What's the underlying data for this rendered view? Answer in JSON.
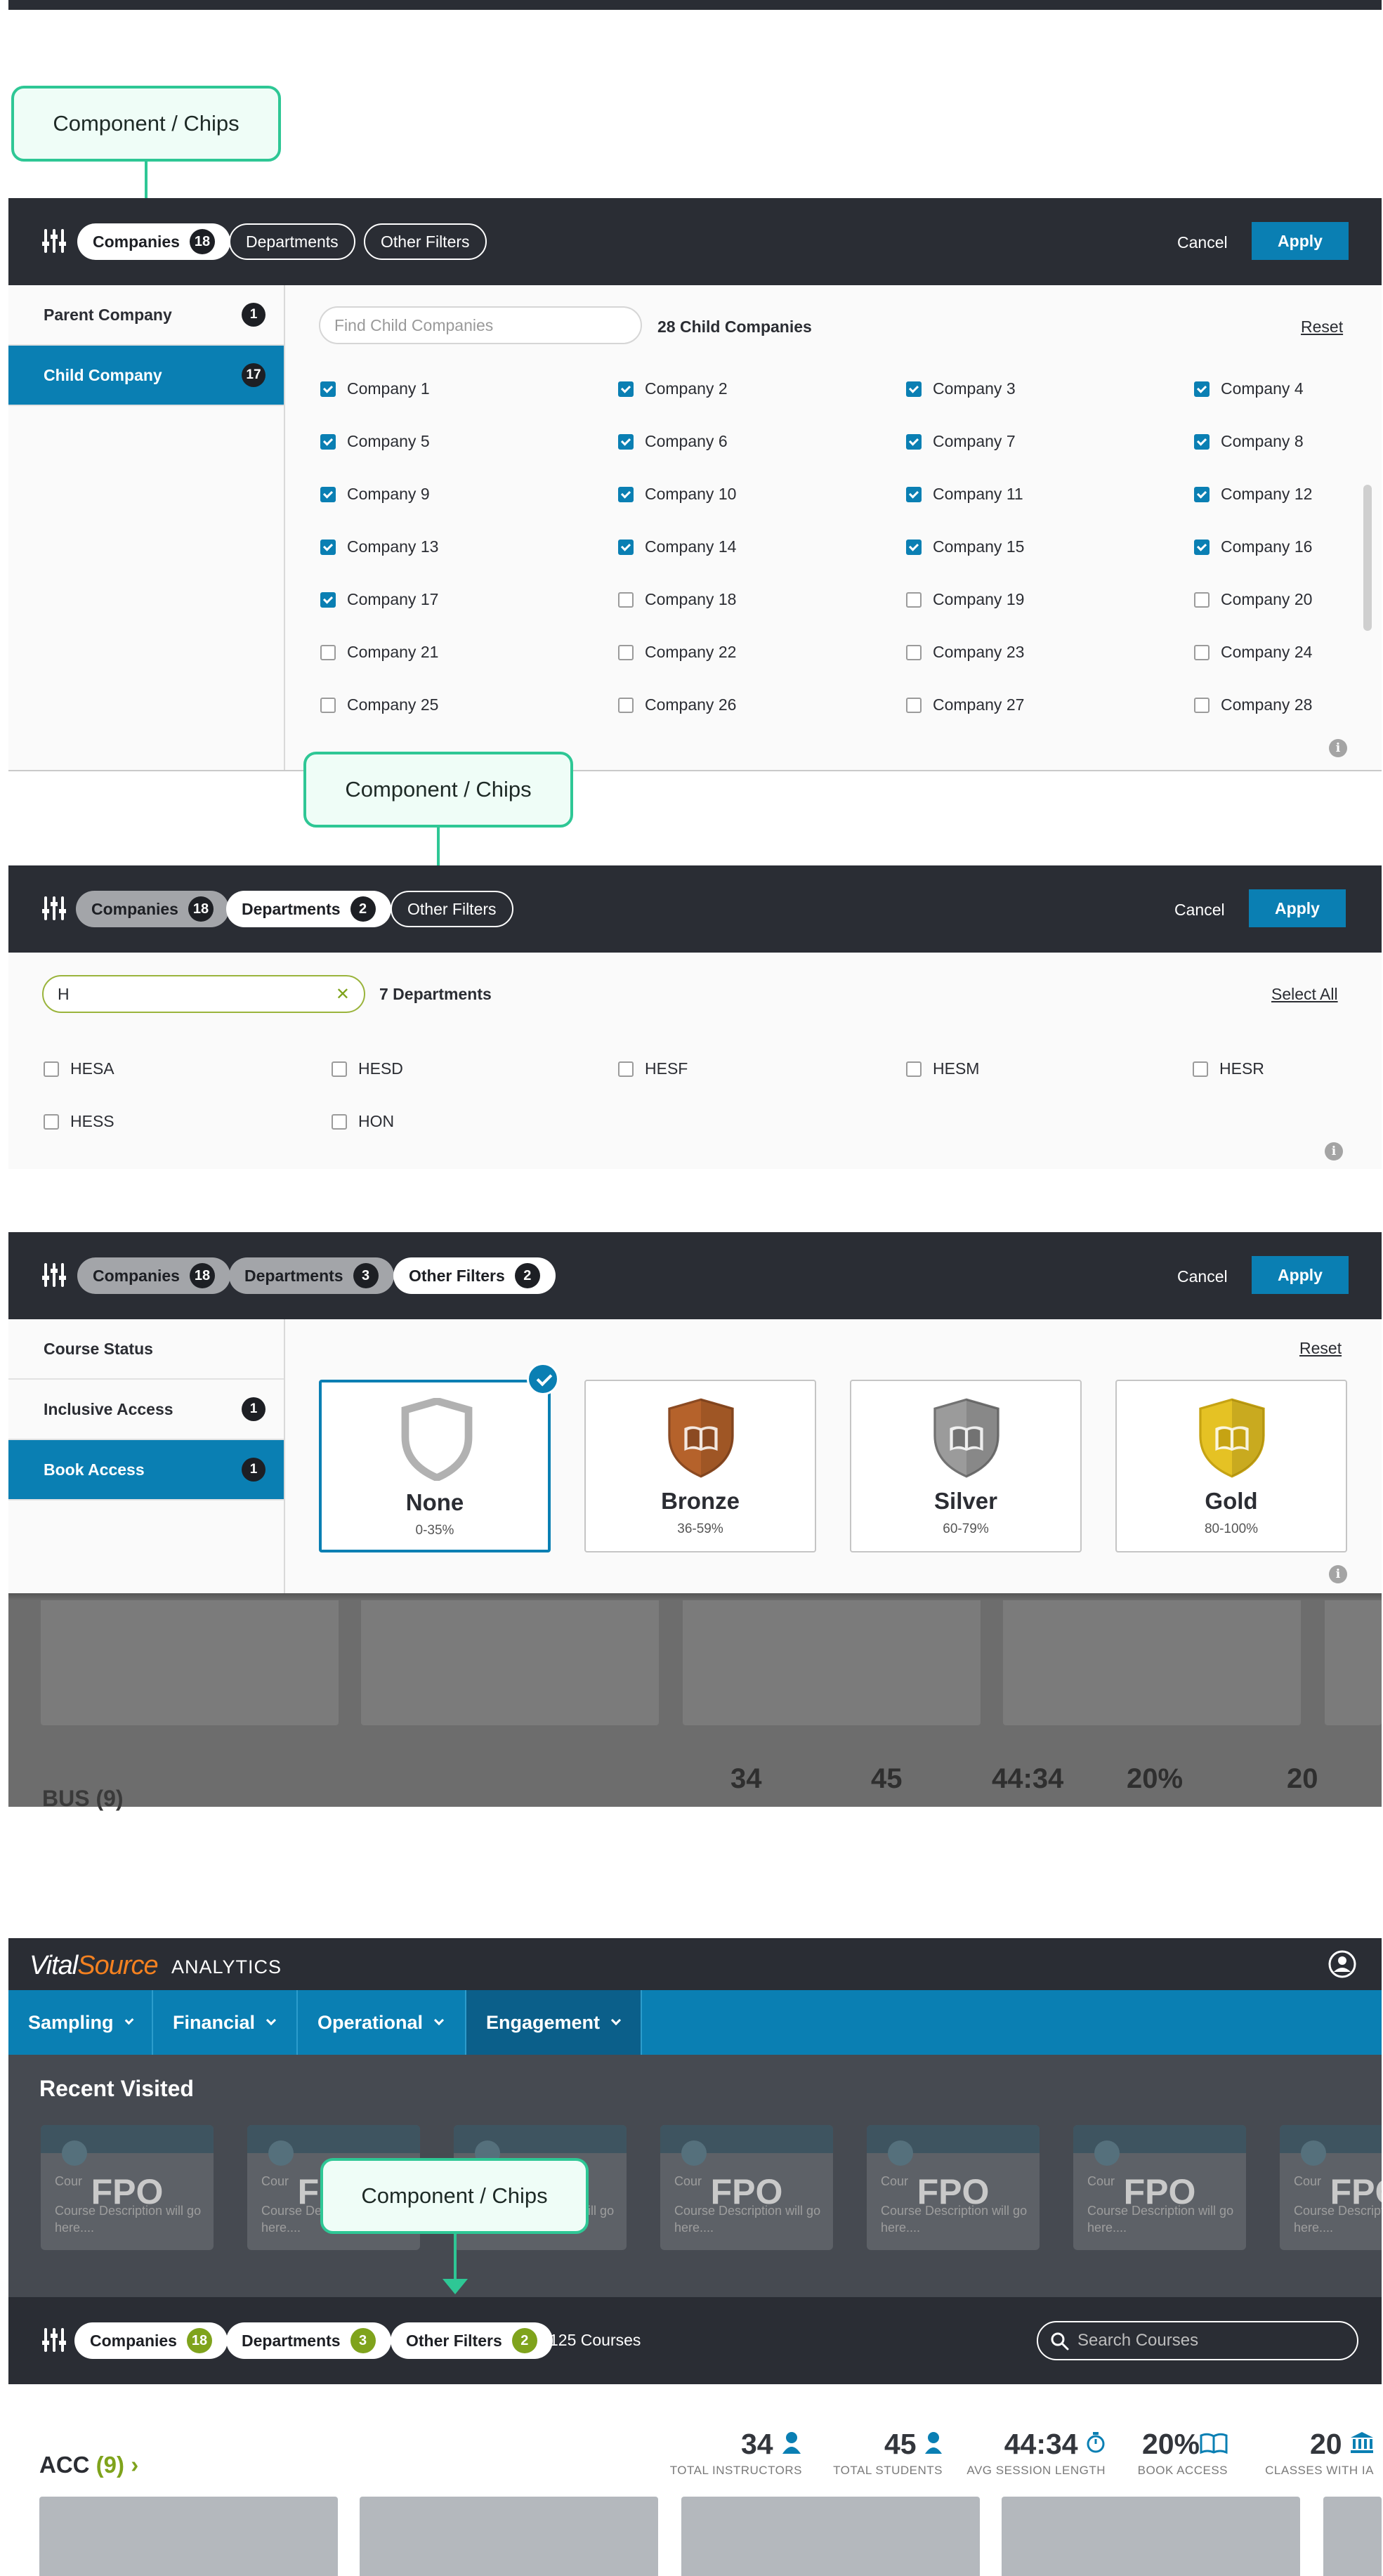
{
  "callouts": [
    "Component / Chips",
    "Component / Chips",
    "Component / Chips"
  ],
  "section1": {
    "chips": [
      {
        "label": "Companies",
        "badge": "18"
      },
      {
        "label": "Departments"
      },
      {
        "label": "Other Filters"
      }
    ],
    "cancel": "Cancel",
    "apply": "Apply",
    "side": [
      {
        "label": "Parent Company",
        "badge": "1"
      },
      {
        "label": "Child Company",
        "badge": "17"
      }
    ],
    "search_placeholder": "Find Child Companies",
    "count": "28 Child Companies",
    "reset": "Reset",
    "companies": [
      {
        "label": "Company 1",
        "checked": true
      },
      {
        "label": "Company 2",
        "checked": true
      },
      {
        "label": "Company 3",
        "checked": true
      },
      {
        "label": "Company 4",
        "checked": true
      },
      {
        "label": "Company 5",
        "checked": true
      },
      {
        "label": "Company 6",
        "checked": true
      },
      {
        "label": "Company 7",
        "checked": true
      },
      {
        "label": "Company 8",
        "checked": true
      },
      {
        "label": "Company 9",
        "checked": true
      },
      {
        "label": "Company 10",
        "checked": true
      },
      {
        "label": "Company 11",
        "checked": true
      },
      {
        "label": "Company 12",
        "checked": true
      },
      {
        "label": "Company 13",
        "checked": true
      },
      {
        "label": "Company 14",
        "checked": true
      },
      {
        "label": "Company 15",
        "checked": true
      },
      {
        "label": "Company 16",
        "checked": true
      },
      {
        "label": "Company 17",
        "checked": true
      },
      {
        "label": "Company 18",
        "checked": false
      },
      {
        "label": "Company 19",
        "checked": false
      },
      {
        "label": "Company 20",
        "checked": false
      },
      {
        "label": "Company 21",
        "checked": false
      },
      {
        "label": "Company 22",
        "checked": false
      },
      {
        "label": "Company 23",
        "checked": false
      },
      {
        "label": "Company 24",
        "checked": false
      },
      {
        "label": "Company 25",
        "checked": false
      },
      {
        "label": "Company 26",
        "checked": false
      },
      {
        "label": "Company 27",
        "checked": false
      },
      {
        "label": "Company 28",
        "checked": false
      }
    ]
  },
  "section2": {
    "chips": [
      {
        "label": "Companies",
        "badge": "18"
      },
      {
        "label": "Departments",
        "badge": "2"
      },
      {
        "label": "Other Filters"
      }
    ],
    "cancel": "Cancel",
    "apply": "Apply",
    "search_value": "H",
    "clear_glyph": "✕",
    "count": "7 Departments",
    "select_all": "Select All",
    "departments": [
      "HESA",
      "HESD",
      "HESF",
      "HESM",
      "HESR",
      "HESS",
      "HON"
    ]
  },
  "section3": {
    "chips": [
      {
        "label": "Companies",
        "badge": "18"
      },
      {
        "label": "Departments",
        "badge": "3"
      },
      {
        "label": "Other Filters",
        "badge": "2"
      }
    ],
    "cancel": "Cancel",
    "apply": "Apply",
    "side": [
      {
        "label": "Course Status"
      },
      {
        "label": "Inclusive Access",
        "badge": "1"
      },
      {
        "label": "Book Access",
        "badge": "1"
      }
    ],
    "reset": "Reset",
    "levels": [
      {
        "name": "None",
        "range": "0-35%",
        "color": "#ffffff",
        "stroke": "#b1b1b1",
        "selected": true
      },
      {
        "name": "Bronze",
        "range": "36-59%",
        "color": "#b5622b",
        "stroke": "#8b4a22",
        "selected": false
      },
      {
        "name": "Silver",
        "range": "60-79%",
        "color": "#9b9b9b",
        "stroke": "#727272",
        "selected": false
      },
      {
        "name": "Gold",
        "range": "80-100%",
        "color": "#e5c224",
        "stroke": "#c6a313",
        "selected": false
      }
    ],
    "bg_title": "BUS (9)",
    "bg_stats": [
      "34",
      "45",
      "44:34",
      "20%",
      "20"
    ]
  },
  "app": {
    "logo_a": "Vital",
    "logo_b": "Source",
    "product": "ANALYTICS",
    "nav": [
      {
        "label": "Sampling"
      },
      {
        "label": "Financial"
      },
      {
        "label": "Operational"
      },
      {
        "label": "Engagement",
        "active": true
      }
    ],
    "recent_title": "Recent Visited",
    "card_fpo": "FPO",
    "card_course_prefix": "Cour",
    "card_desc": "Course Description will go here....",
    "chips": [
      {
        "label": "Companies",
        "badge": "18"
      },
      {
        "label": "Departments",
        "badge": "3"
      },
      {
        "label": "Other Filters",
        "badge": "2"
      }
    ],
    "courses_count": "125 Courses",
    "search_placeholder": "Search Courses",
    "acc_title": "ACC",
    "acc_count": "(9)",
    "stats": [
      {
        "value": "34",
        "label": "TOTAL INSTRUCTORS"
      },
      {
        "value": "45",
        "label": "TOTAL STUDENTS"
      },
      {
        "value": "44:34",
        "label": "AVG SESSION LENGTH"
      },
      {
        "value": "20%",
        "label": "BOOK ACCESS"
      },
      {
        "value": "20",
        "label": "CLASSES WITH IA"
      }
    ]
  },
  "colors": {
    "accent": "#0a7fb3",
    "callout": "#2ec795",
    "dark": "#2a2d34",
    "green_badge": "#7fa31c"
  }
}
